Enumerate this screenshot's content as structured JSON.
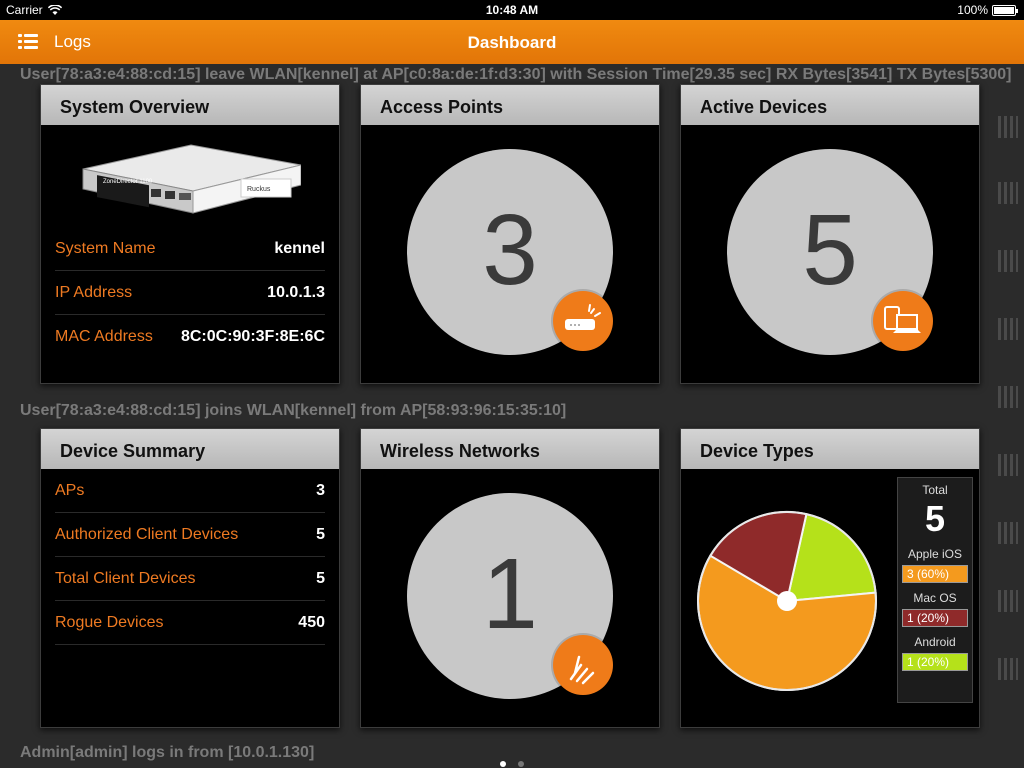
{
  "status_bar": {
    "carrier": "Carrier",
    "time": "10:48 AM",
    "battery": "100%",
    "battery_level": 1.0
  },
  "nav": {
    "logs_label": "Logs",
    "title": "Dashboard",
    "menu_icon": "list-icon"
  },
  "background_logs": [
    "User[78:a3:e4:88:cd:15] leave WLAN[kennel] at AP[c0:8a:de:1f:d3:30] with Session Time[29.35 sec] RX Bytes[3541] TX Bytes[5300]",
    "User[78:a3:e4:88:cd:15] joins WLAN[kennel] from AP[58:93:96:15:35:10]",
    "Admin[admin] logs in from [10.0.1.130]"
  ],
  "system_overview": {
    "title": "System Overview",
    "device_label": "ZoneDirector 1100",
    "device_brand": "Ruckus",
    "rows": [
      {
        "label": "System Name",
        "value": "kennel"
      },
      {
        "label": "IP Address",
        "value": "10.0.1.3"
      },
      {
        "label": "MAC Address",
        "value": "8C:0C:90:3F:8E:6C"
      }
    ]
  },
  "access_points": {
    "title": "Access Points",
    "count": "3",
    "icon": "access-point-icon"
  },
  "active_devices": {
    "title": "Active Devices",
    "count": "5",
    "icon": "devices-icon"
  },
  "device_summary": {
    "title": "Device Summary",
    "rows": [
      {
        "label": "APs",
        "value": "3"
      },
      {
        "label": "Authorized Client Devices",
        "value": "5"
      },
      {
        "label": "Total Client Devices",
        "value": "5"
      },
      {
        "label": "Rogue Devices",
        "value": "450"
      }
    ]
  },
  "wireless_networks": {
    "title": "Wireless Networks",
    "count": "1",
    "icon": "wireless-signal-icon"
  },
  "device_types": {
    "title": "Device Types",
    "total_label": "Total",
    "total": "5",
    "items": [
      {
        "name": "Apple iOS",
        "value": "3 (60%)",
        "count": 3,
        "color": "#f49a1e"
      },
      {
        "name": "Mac OS",
        "value": "1 (20%)",
        "count": 1,
        "color": "#8f2a2a"
      },
      {
        "name": "Android",
        "value": "1 (20%)",
        "count": 1,
        "color": "#b5e11a"
      }
    ]
  },
  "pager": {
    "pages": 2,
    "current": 1
  },
  "colors": {
    "accent": "#ee7a22",
    "nav": "#e97f0c",
    "card_header": "#c6c6c6"
  }
}
